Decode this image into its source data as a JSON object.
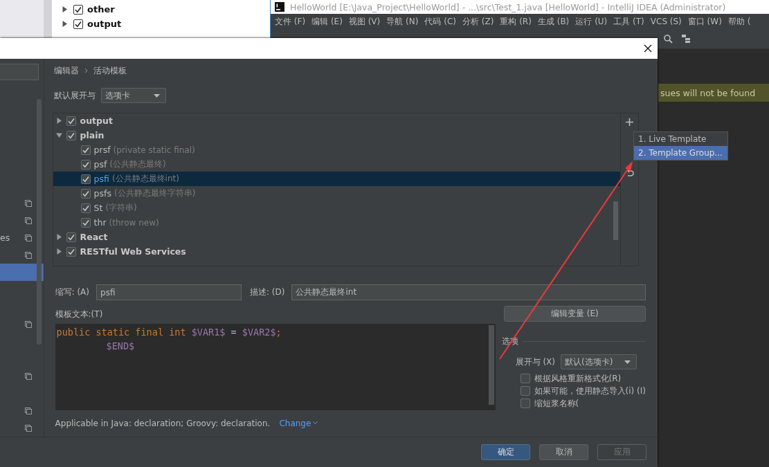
{
  "background_tree": {
    "items": [
      {
        "label": "other",
        "checked": true,
        "expanded": false
      },
      {
        "label": "output",
        "checked": true,
        "expanded": false
      }
    ]
  },
  "ide": {
    "title": "HelloWorld [E:\\Java_Project\\HelloWorld] - ...\\src\\Test_1.java [HelloWorld] - IntelliJ IDEA (Administrator)",
    "menu": [
      "文件 (F)",
      "编辑 (E)",
      "视图 (V)",
      "导航 (N)",
      "代码 (C)",
      "分析 (Z)",
      "重构 (R)",
      "生成 (B)",
      "运行 (U)",
      "工具 (T)",
      "VCS (S)",
      "窗口 (W)",
      "帮助 ("
    ],
    "banner": "sues will not be found"
  },
  "dialog": {
    "sidebar": {
      "rows": [
        {
          "kind": "plain",
          "selected": false
        },
        {
          "kind": "shared",
          "selected": false
        },
        {
          "kind": "shared",
          "selected": false
        },
        {
          "kind": "shared",
          "label": "es",
          "selected": false
        },
        {
          "kind": "shared",
          "selected": false
        },
        {
          "kind": "plain",
          "selected": true
        },
        {
          "kind": "plain",
          "selected": false
        },
        {
          "kind": "plain",
          "selected": false
        },
        {
          "kind": "shared",
          "selected": false
        },
        {
          "kind": "plain",
          "selected": false
        },
        {
          "kind": "plain",
          "selected": false
        },
        {
          "kind": "shared",
          "selected": false
        },
        {
          "kind": "plain",
          "selected": false
        },
        {
          "kind": "shared",
          "selected": false
        },
        {
          "kind": "shared",
          "selected": false
        }
      ]
    },
    "breadcrumb": [
      "编辑器",
      "活动模板"
    ],
    "expand_default": {
      "label": "默认展开与",
      "value": "选项卡"
    },
    "tree": {
      "groups": [
        {
          "name": "output",
          "checked": true,
          "expanded": false
        },
        {
          "name": "plain",
          "checked": true,
          "expanded": true,
          "children": [
            {
              "abbr": "prsf",
              "desc": "(private static final)",
              "checked": true,
              "selected": false
            },
            {
              "abbr": "psf",
              "desc": "(公共静态最终)",
              "checked": true,
              "selected": false
            },
            {
              "abbr": "psfi",
              "desc": "(公共静态最终int)",
              "checked": true,
              "selected": true
            },
            {
              "abbr": "psfs",
              "desc": "(公共静态最终字符串)",
              "checked": true,
              "selected": false
            },
            {
              "abbr": "St",
              "desc": "(字符串)",
              "checked": true,
              "selected": false
            },
            {
              "abbr": "thr",
              "desc": "(throw new)",
              "checked": true,
              "selected": false
            }
          ]
        },
        {
          "name": "React",
          "checked": true,
          "expanded": false
        },
        {
          "name": "RESTful Web Services",
          "checked": true,
          "expanded": false
        }
      ]
    },
    "add_menu": [
      {
        "label": "1. Live Template",
        "selected": false
      },
      {
        "label": "2. Template Group...",
        "selected": true
      }
    ],
    "abbreviation": {
      "label": "缩写: (A)",
      "value": "psfi"
    },
    "description": {
      "label": "描述: (D)",
      "value": "公共静态最终int"
    },
    "template_text": {
      "label": "模板文本:(T)",
      "lines": [
        {
          "indented": false,
          "tokens": [
            {
              "kind": "keyword",
              "text": "public static final int "
            },
            {
              "kind": "variable",
              "text": "$VAR1$"
            },
            {
              "kind": "plain",
              "text": " = "
            },
            {
              "kind": "variable",
              "text": "$VAR2$"
            },
            {
              "kind": "keyword",
              "text": ";"
            }
          ]
        },
        {
          "indented": true,
          "tokens": [
            {
              "kind": "variable",
              "text": "$END$"
            }
          ]
        }
      ]
    },
    "edit_variables_button": "编辑变量 (E)",
    "options": {
      "title": "选项",
      "expand_label": "展开与 (X)",
      "expand_value": "默认(选项卡)",
      "checkboxes": [
        {
          "label": "根据风格重新格式化(R)",
          "checked": false
        },
        {
          "label": "如果可能，使用静态导入(i) (I)",
          "checked": false
        },
        {
          "label": "缩短浆名称(",
          "checked": false
        }
      ]
    },
    "applicable": "Applicable in Java: declaration; Groovy: declaration.",
    "change_link": "Change",
    "buttons": [
      {
        "label": "确定",
        "kind": "primary"
      },
      {
        "label": "取消",
        "kind": "normal"
      },
      {
        "label": "应用",
        "kind": "disabled"
      }
    ]
  }
}
